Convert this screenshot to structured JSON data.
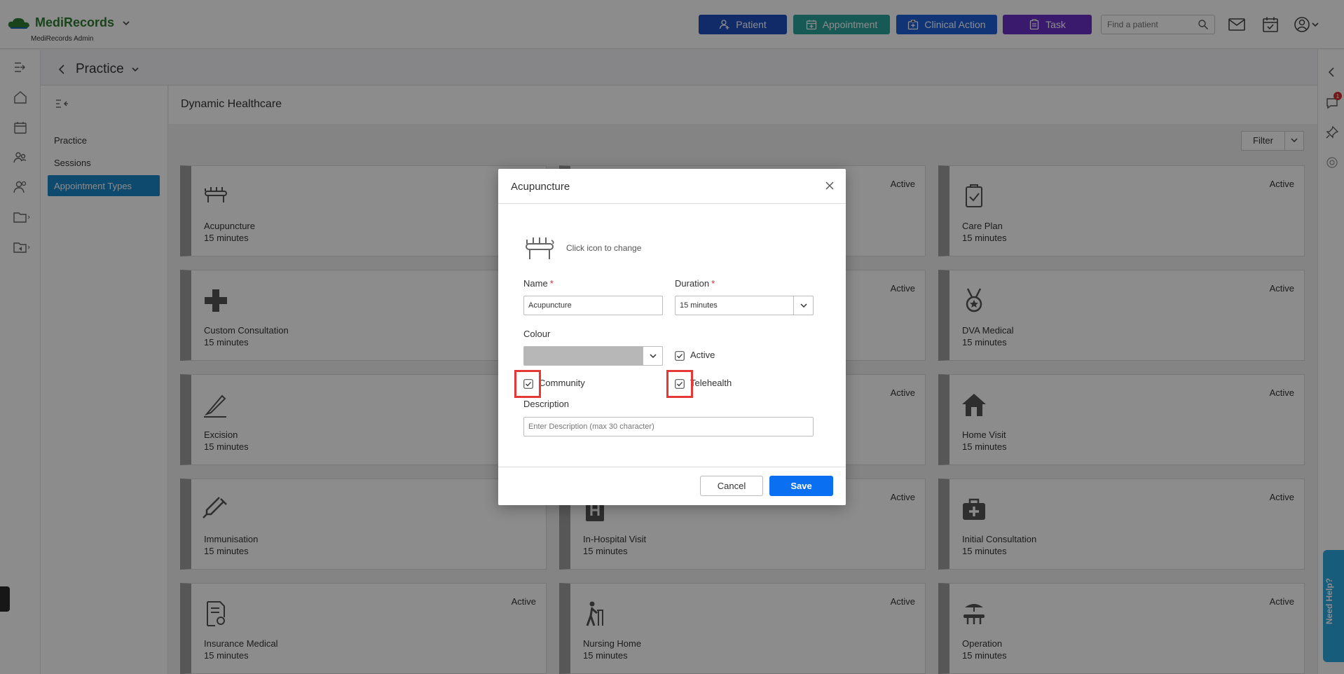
{
  "app": {
    "brand": "MediRecords",
    "subtitle": "MediRecords Admin"
  },
  "topbar": {
    "patient_label": "Patient",
    "appointment_label": "Appointment",
    "clinical_action_label": "Clinical Action",
    "task_label": "Task",
    "search_placeholder": "Find a patient",
    "colors": {
      "patient": "#1f4fbf",
      "appointment": "#2aa39b",
      "clinical": "#1e5fd8",
      "task": "#6b31c6"
    }
  },
  "page": {
    "title": "Practice"
  },
  "subnav": {
    "items": [
      {
        "label": "Practice"
      },
      {
        "label": "Sessions"
      },
      {
        "label": "Appointment Types"
      }
    ]
  },
  "content": {
    "title": "Dynamic Healthcare",
    "filter_label": "Filter"
  },
  "cards": [
    {
      "name": "Acupuncture",
      "duration": "15 minutes",
      "status": "",
      "icon": "massage-table-icon"
    },
    {
      "name": "",
      "duration": "",
      "status": "Active",
      "icon": ""
    },
    {
      "name": "Care Plan",
      "duration": "15 minutes",
      "status": "Active",
      "icon": "clipboard-check-icon"
    },
    {
      "name": "Custom Consultation",
      "duration": "15 minutes",
      "status": "",
      "icon": "medical-cross-icon"
    },
    {
      "name": "",
      "duration": "",
      "status": "Active",
      "icon": ""
    },
    {
      "name": "DVA Medical",
      "duration": "15 minutes",
      "status": "Active",
      "icon": "medal-icon"
    },
    {
      "name": "Excision",
      "duration": "15 minutes",
      "status": "",
      "icon": "scalpel-icon"
    },
    {
      "name": "",
      "duration": "",
      "status": "Active",
      "icon": ""
    },
    {
      "name": "Home Visit",
      "duration": "15 minutes",
      "status": "Active",
      "icon": "house-icon"
    },
    {
      "name": "Immunisation",
      "duration": "15 minutes",
      "status": "",
      "icon": "syringe-icon"
    },
    {
      "name": "In-Hospital Visit",
      "duration": "15 minutes",
      "status": "Active",
      "icon": "hospital-icon"
    },
    {
      "name": "Initial Consultation",
      "duration": "15 minutes",
      "status": "Active",
      "icon": "medical-kit-icon"
    },
    {
      "name": "Insurance Medical",
      "duration": "15 minutes",
      "status": "Active",
      "icon": "document-certificate-icon"
    },
    {
      "name": "Nursing Home",
      "duration": "15 minutes",
      "status": "Active",
      "icon": "walker-person-icon"
    },
    {
      "name": "Operation",
      "duration": "15 minutes",
      "status": "Active",
      "icon": "operation-lamp-icon"
    }
  ],
  "rrail": {
    "badge_count": "1",
    "help_label": "Need Help?"
  },
  "modal": {
    "title": "Acupuncture",
    "icon_hint": "Click icon to change",
    "name_label": "Name",
    "required_mark": "*",
    "name_value": "Acupuncture",
    "duration_label": "Duration",
    "duration_value": "15 minutes",
    "colour_label": "Colour",
    "colour_value": "#b7b7b7",
    "active_label": "Active",
    "active_checked": true,
    "community_label": "Community",
    "community_checked": true,
    "telehealth_label": "Telehealth",
    "telehealth_checked": true,
    "description_label": "Description",
    "description_placeholder": "Enter Description (max 30 character)",
    "cancel_label": "Cancel",
    "save_label": "Save"
  }
}
